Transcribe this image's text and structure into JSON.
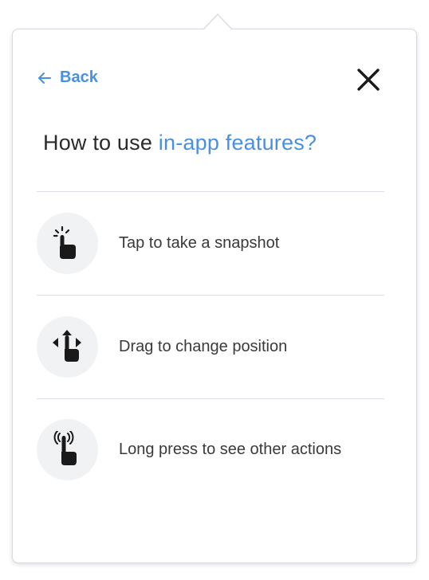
{
  "popover": {
    "back_label": "Back",
    "title_prefix": "How to use ",
    "title_accent": "in-app features?",
    "accent_color": "#4a90e2"
  },
  "features": [
    {
      "icon": "tap-gesture-icon",
      "label": "Tap to take a snapshot"
    },
    {
      "icon": "drag-gesture-icon",
      "label": "Drag to change position"
    },
    {
      "icon": "long-press-gesture-icon",
      "label": "Long press to see other actions"
    }
  ],
  "icons": {
    "back": "arrow-left-icon",
    "close": "close-icon"
  }
}
